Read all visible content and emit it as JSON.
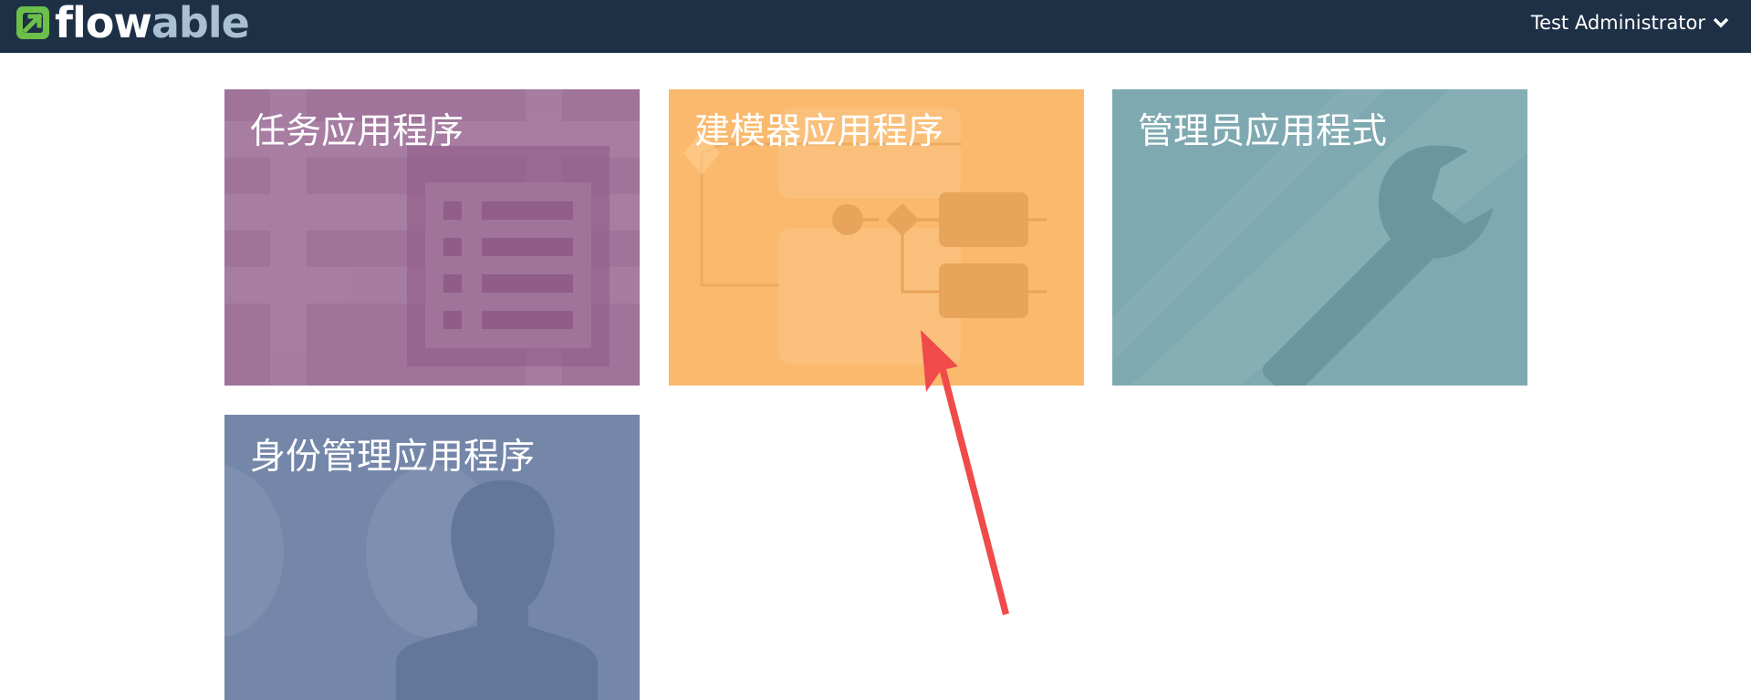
{
  "header": {
    "logo": {
      "text_part1": "flow",
      "text_part2": "able",
      "icon": "flowable-logo-icon"
    },
    "user": {
      "name": "Test Administrator",
      "icon": "chevron-down-icon"
    }
  },
  "apps": [
    {
      "title": "任务应用程序",
      "color": "#a0739b",
      "icon": "task-list-icon"
    },
    {
      "title": "建模器应用程序",
      "color": "#fab96c",
      "icon": "process-diagram-icon"
    },
    {
      "title": "管理员应用程式",
      "color": "#7fa9b1",
      "icon": "wrench-icon"
    },
    {
      "title": "身份管理应用程序",
      "color": "#7587a9",
      "icon": "user-silhouette-icon"
    }
  ],
  "annotation": {
    "icon": "red-arrow-icon",
    "color": "#f04a4a"
  }
}
